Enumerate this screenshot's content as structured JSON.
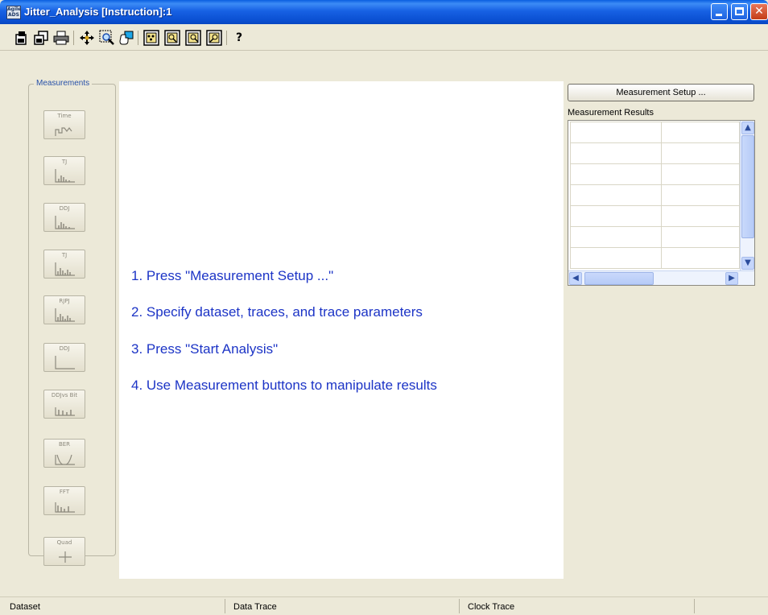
{
  "window": {
    "title": "Jitter_Analysis [Instruction]:1",
    "app_icon_text": "Agilent ADS"
  },
  "toolbar": {
    "icons": [
      "open-icon",
      "copy-icon",
      "print-icon",
      "move-icon",
      "zoom-box-icon",
      "pan-icon",
      "marker-1-icon",
      "marker-2-icon",
      "marker-3-icon",
      "marker-4-icon",
      "help-icon"
    ],
    "help_glyph": "?"
  },
  "measurements": {
    "legend": "Measurements",
    "buttons": [
      {
        "label": "Time",
        "icon": "waveform-icon"
      },
      {
        "label": "TJ",
        "icon": "histogram-icon"
      },
      {
        "label": "DDJ",
        "icon": "histogram-icon"
      },
      {
        "label": "TJ",
        "icon": "bathtub-histogram-icon"
      },
      {
        "label": "RJPJ",
        "icon": "histogram-icon"
      },
      {
        "label": "DDJ",
        "icon": "step-icon"
      },
      {
        "label": "DDJvs Bit",
        "icon": "bar-icon"
      },
      {
        "label": "BER",
        "icon": "bathtub-icon"
      },
      {
        "label": "FFT",
        "icon": "spectrum-icon"
      },
      {
        "label": "Quad",
        "icon": "crosshair-icon"
      }
    ]
  },
  "instructions": [
    "1. Press \"Measurement Setup ...\"",
    "2. Specify dataset, traces, and trace parameters",
    "3. Press \"Start Analysis\"",
    "4. Use Measurement buttons to manipulate results"
  ],
  "setup_button": {
    "label": "Measurement Setup ..."
  },
  "results": {
    "label": "Measurement Results",
    "rows": 7,
    "columns": 2
  },
  "statusbar": {
    "dataset": "Dataset",
    "data_trace": "Data Trace",
    "clock_trace": "Clock Trace"
  },
  "colors": {
    "instruction_text": "#1c34c6",
    "title_bar": "#0a5fe0",
    "window_bg": "#ece9d8"
  }
}
